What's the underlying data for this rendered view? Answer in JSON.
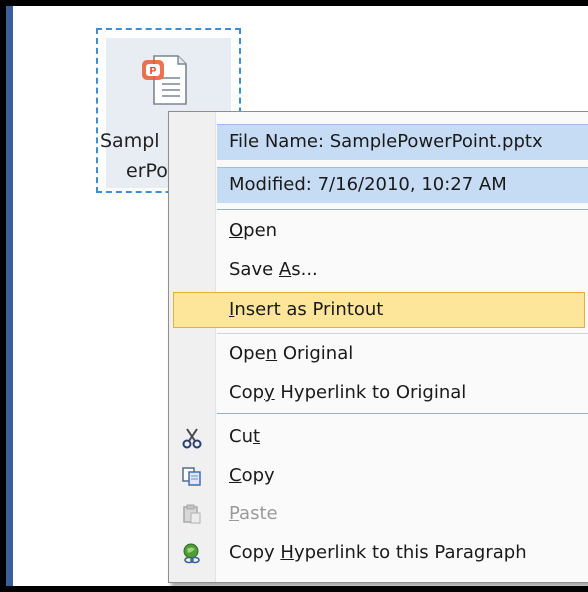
{
  "file": {
    "label_line1": "Sampl",
    "label_line2": "erPo"
  },
  "menu": {
    "info": [
      {
        "text": "File Name: SamplePowerPoint.pptx"
      },
      {
        "text": "Modified: 7/16/2010, 10:27 AM"
      }
    ],
    "items": [
      {
        "pre": "",
        "acc": "O",
        "post": "pen",
        "icon": null,
        "disabled": false
      },
      {
        "pre": "Save ",
        "acc": "A",
        "post": "s...",
        "icon": null,
        "disabled": false
      },
      {
        "pre": "",
        "acc": "I",
        "post": "nsert as Printout",
        "icon": null,
        "disabled": false,
        "highlighted": true
      },
      {
        "pre": "Ope",
        "acc": "n",
        "post": " Original",
        "icon": null,
        "disabled": false
      },
      {
        "pre": "Cop",
        "acc": "y",
        "post": " Hyperlink to Original",
        "icon": null,
        "disabled": false
      },
      {
        "pre": "Cu",
        "acc": "t",
        "post": "",
        "icon": "scissors-icon",
        "disabled": false
      },
      {
        "pre": "",
        "acc": "C",
        "post": "opy",
        "icon": "copy-icon",
        "disabled": false
      },
      {
        "pre": "",
        "acc": "P",
        "post": "aste",
        "icon": "paste-icon",
        "disabled": true
      },
      {
        "pre": "Copy ",
        "acc": "H",
        "post": "yperlink to this Paragraph",
        "icon": "hyperlink-paragraph-icon",
        "disabled": false
      }
    ]
  },
  "colors": {
    "highlight": "#fde59a",
    "info_band": "#c6dbf4",
    "selection_border": "#3c8ed8"
  }
}
